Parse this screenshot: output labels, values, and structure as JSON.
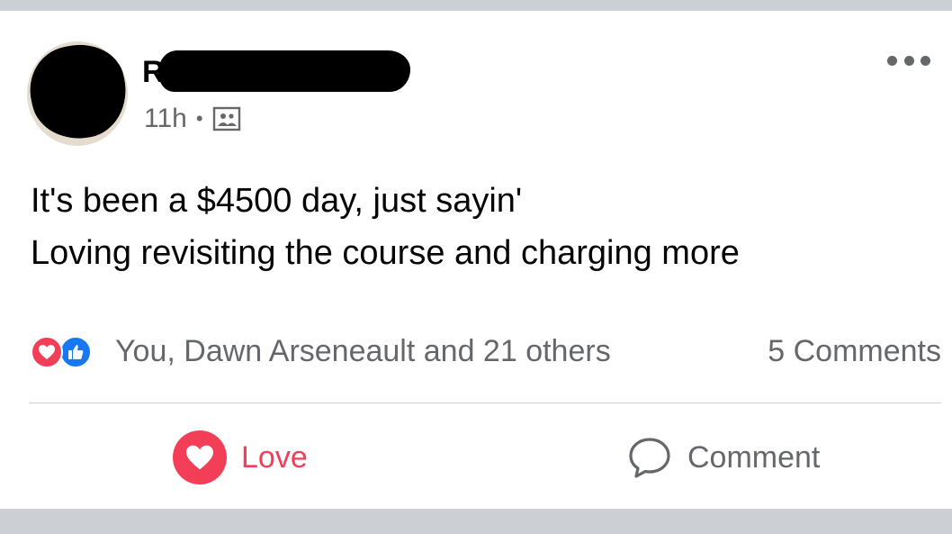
{
  "post": {
    "author": {
      "name_visible_initial": "R",
      "avatar_redacted": true
    },
    "timestamp": "11h",
    "separator_dot": "•",
    "privacy_icon": "friends-photo-icon",
    "menu_icon": "more-options-icon",
    "text_lines": [
      "It's been a $4500 day, just sayin'",
      "Loving revisiting the course and charging more"
    ],
    "reactions": {
      "icons": [
        "love-reaction-icon",
        "like-reaction-icon"
      ],
      "summary": "You, Dawn Arseneault and 21 others"
    },
    "comments_count": "5 Comments",
    "actions": {
      "love_label": "Love",
      "comment_label": "Comment"
    }
  },
  "colors": {
    "love_red": "#f33e58",
    "like_blue": "#1877f2",
    "secondary_text": "#65676b",
    "divider": "#ccd0d5"
  }
}
